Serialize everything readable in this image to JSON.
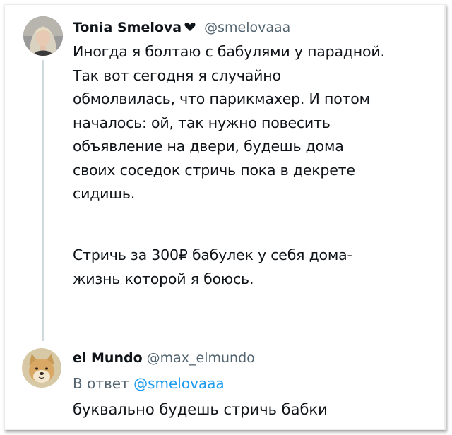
{
  "tweet": {
    "author_name": "Tonia Smelova",
    "author_handle": "@smelovaaa",
    "paragraph1_lines": [
      "Иногда я болтаю с бабулями у парадной.",
      "Так вот сегодня я случайно",
      "обмолвилась, что парикмахер. И потом",
      "началось: ой, так нужно повесить",
      "объявление на двери, будешь дома",
      "своих соседок стричь пока в декрете",
      "сидишь."
    ],
    "paragraph2_lines": [
      "Стричь за 300₽ бабулек у себя дома-",
      "жизнь которой я боюсь."
    ]
  },
  "reply": {
    "author_name": "el Mundo",
    "author_handle": "@max_elmundo",
    "reply_prefix": "В ответ",
    "reply_to_handle": "@smelovaaa",
    "text": "буквально будешь стричь бабки"
  },
  "colors": {
    "text": "#0f1419",
    "secondary": "#536471",
    "link": "#1d9bf0",
    "thread_line": "#cfd9de"
  },
  "icons": {
    "author_badge": "heart-badge-icon",
    "avatar_1": "woman-portrait",
    "avatar_2": "shiba-doge-portrait"
  }
}
